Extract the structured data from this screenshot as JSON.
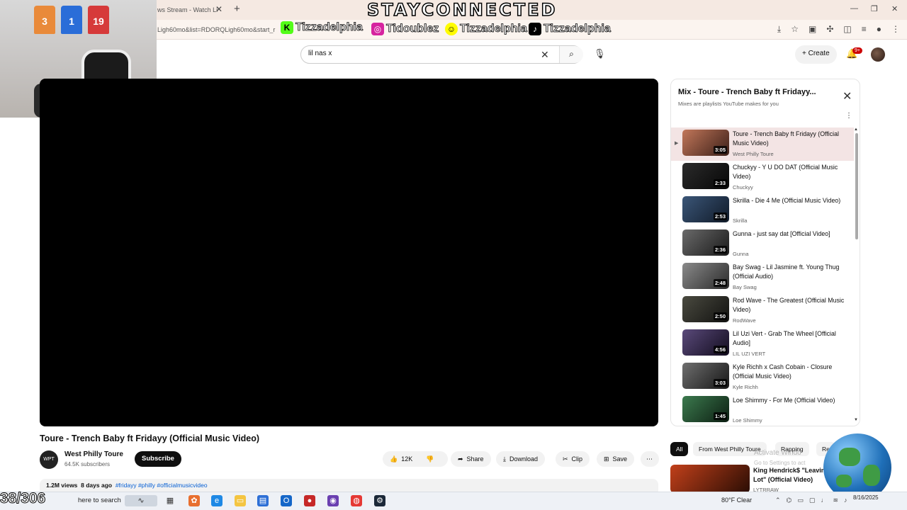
{
  "browser": {
    "tab_title": "ws Stream - Watch Li",
    "url": "Ligh60mo&list=RDORQLigh60mo&start_r",
    "overlay_title": "STAYCONNECTED",
    "socials": [
      {
        "icon": "kick-icon",
        "handle": "Tizzadelphia",
        "color": "#53fc18"
      },
      {
        "icon": "instagram-icon",
        "handle": "Tidoublez",
        "color": "#d6249f"
      },
      {
        "icon": "snapchat-icon",
        "handle": "Tizzadelphia",
        "color": "#fffc00"
      },
      {
        "icon": "tiktok-icon",
        "handle": "Tizzadelphia",
        "color": "#000000"
      }
    ]
  },
  "webcam": {
    "jerseys": [
      {
        "number": "3",
        "color": "#e98a3a"
      },
      {
        "number": "1",
        "color": "#2a6dd8"
      },
      {
        "number": "19",
        "color": "#d63a3a"
      }
    ]
  },
  "youtube": {
    "search_value": "lil nas x",
    "create_label": "Create",
    "notification_count": "9+"
  },
  "video": {
    "title": "Toure - Trench Baby ft Fridayy (Official Music Video)",
    "channel_avatar_text": "WPT",
    "channel_name": "West Philly Toure",
    "subscribers": "64.5K subscribers",
    "subscribe_label": "Subscribe",
    "likes": "12K",
    "share_label": "Share",
    "download_label": "Download",
    "clip_label": "Clip",
    "save_label": "Save",
    "views": "1.2M views",
    "age": "8 days ago",
    "tags": "#fridayy #philly #officialmusicvideo"
  },
  "playlist": {
    "title": "Mix - Toure - Trench Baby ft Fridayy...",
    "subtitle": "Mixes are playlists YouTube makes for you",
    "items": [
      {
        "title": "Toure - Trench Baby ft Fridayy (Official Music Video)",
        "channel": "West Philly Toure",
        "duration": "3:05",
        "active": true
      },
      {
        "title": "Chuckyy - Y U DO DAT (Official Music Video)",
        "channel": "Chuckyy",
        "duration": "2:33"
      },
      {
        "title": "Skrilla - Die 4 Me (Official Music Video)",
        "channel": "Skrilla",
        "duration": "2:53"
      },
      {
        "title": "Gunna - just say dat [Official Video]",
        "channel": "Gunna",
        "duration": "2:36"
      },
      {
        "title": "Bay Swag - Lil Jasmine ft. Young Thug (Official Audio)",
        "channel": "Bay Swag",
        "duration": "2:48"
      },
      {
        "title": "Rod Wave - The Greatest (Official Music Video)",
        "channel": "RodWave",
        "duration": "2:50"
      },
      {
        "title": "Lil Uzi Vert - Grab The Wheel [Official Audio]",
        "channel": "LIL UZI VERT",
        "duration": "4:56"
      },
      {
        "title": "Kyle Richh x Cash Cobain - Closure (Official Music Video)",
        "channel": "Kyle Richh",
        "duration": "3:03"
      },
      {
        "title": "Loe Shimmy - For Me (Official Video)",
        "channel": "Loe Shimmy",
        "duration": "1:45"
      }
    ]
  },
  "chips": [
    "All",
    "From West Philly Toure",
    "Rapping",
    "Re"
  ],
  "recommendation": {
    "title": "King Hendrick$ \"Leavin Lot\" (Official Video)",
    "channel": "LYTRRAW"
  },
  "watermark": {
    "line1": "Activate Windo",
    "line2": "Go to Settings to act"
  },
  "taskbar": {
    "counter": "38/306",
    "search_placeholder": "here to search",
    "weather": "80°F  Clear",
    "time": "",
    "date": "8/16/2025"
  }
}
